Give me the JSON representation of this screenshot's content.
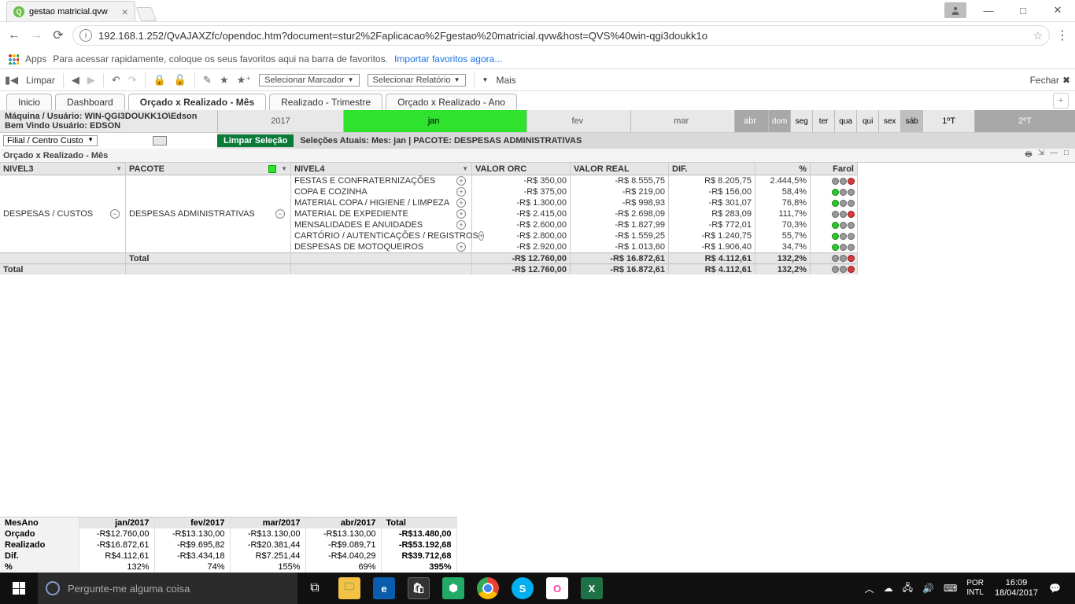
{
  "browser": {
    "tab_title": "gestao matricial.qvw",
    "url": "192.168.1.252/QvAJAXZfc/opendoc.htm?document=stur2%2Faplicacao%2Fgestao%20matricial.qvw&host=QVS%40win-qgi3doukk1o",
    "apps_label": "Apps",
    "bookmark_hint": "Para acessar rapidamente, coloque os seus favoritos aqui na barra de favoritos.",
    "import_link": "Importar favoritos agora..."
  },
  "qv_toolbar": {
    "clear": "Limpar",
    "bookmark_select": "Selecionar Marcador",
    "report_select": "Selecionar Relatório",
    "more": "Mais",
    "close": "Fechar"
  },
  "tabs": [
    "Inicio",
    "Dashboard",
    "Orçado x Realizado - Mês",
    "Realizado - Trimestre",
    "Orçado x Realizado - Ano"
  ],
  "active_tab": "Orçado x Realizado - Mês",
  "info": {
    "machine_user": "Máquina / Usuário: WIN-QGI3DOUKK1O\\Edson",
    "welcome": "Bem Vindo Usuário: EDSON",
    "year": "2017",
    "months": [
      "jan",
      "fev",
      "mar",
      "abr"
    ],
    "days": [
      "dom",
      "seg",
      "ter",
      "qua",
      "qui",
      "sex",
      "sáb"
    ],
    "quarters": [
      "1ºT",
      "2ºT"
    ]
  },
  "filter_label": "Filial / Centro Custo",
  "clear_sel": "Limpar Seleção",
  "current_sel": "Seleções Atuais: Mes: jan | PACOTE: DESPESAS ADMINISTRATIVAS",
  "object_title": "Orçado x Realizado - Mês",
  "pivot": {
    "cols": [
      "NIVEL3",
      "PACOTE",
      "NIVEL4",
      "VALOR ORC",
      "VALOR REAL",
      "DIF.",
      "%",
      "Farol"
    ],
    "nivel3": "DESPESAS / CUSTOS",
    "pacote": "DESPESAS ADMINISTRATIVAS",
    "rows": [
      {
        "n4": "FESTAS E CONFRATERNIZAÇÕES",
        "orc": "-R$ 350,00",
        "real": "-R$ 8.555,75",
        "dif": "R$ 8.205,75",
        "pct": "2.444,5%",
        "f": "r"
      },
      {
        "n4": "COPA E COZINHA",
        "orc": "-R$ 375,00",
        "real": "-R$ 219,00",
        "dif": "-R$ 156,00",
        "pct": "58,4%",
        "f": "g"
      },
      {
        "n4": "MATERIAL COPA / HIGIENE / LIMPEZA",
        "orc": "-R$ 1.300,00",
        "real": "-R$ 998,93",
        "dif": "-R$ 301,07",
        "pct": "76,8%",
        "f": "g"
      },
      {
        "n4": "MATERIAL DE EXPEDIENTE",
        "orc": "-R$ 2.415,00",
        "real": "-R$ 2.698,09",
        "dif": "R$ 283,09",
        "pct": "111,7%",
        "f": "r"
      },
      {
        "n4": "MENSALIDADES E ANUIDADES",
        "orc": "-R$ 2.600,00",
        "real": "-R$ 1.827,99",
        "dif": "-R$ 772,01",
        "pct": "70,3%",
        "f": "g"
      },
      {
        "n4": "CARTÓRIO / AUTENTICAÇÕES / REGISTROS",
        "orc": "-R$ 2.800,00",
        "real": "-R$ 1.559,25",
        "dif": "-R$ 1.240,75",
        "pct": "55,7%",
        "f": "g"
      },
      {
        "n4": "DESPESAS DE MOTOQUEIROS",
        "orc": "-R$ 2.920,00",
        "real": "-R$ 1.013,60",
        "dif": "-R$ 1.906,40",
        "pct": "34,7%",
        "f": "g"
      }
    ],
    "subtotal_label": "Total",
    "subtotal": {
      "orc": "-R$ 12.760,00",
      "real": "-R$ 16.872,61",
      "dif": "R$ 4.112,61",
      "pct": "132,2%",
      "f": "r"
    },
    "grand_label": "Total",
    "grand": {
      "orc": "-R$ 12.760,00",
      "real": "-R$ 16.872,61",
      "dif": "R$ 4.112,61",
      "pct": "132,2%",
      "f": "r"
    }
  },
  "summary": {
    "header_row": "MesAno",
    "cols": [
      "jan/2017",
      "fev/2017",
      "mar/2017",
      "abr/2017",
      "Total"
    ],
    "rows": [
      {
        "l": "Orçado",
        "v": [
          "-R$12.760,00",
          "-R$13.130,00",
          "-R$13.130,00",
          "-R$13.130,00",
          "-R$13.480,00"
        ]
      },
      {
        "l": "Realizado",
        "v": [
          "-R$16.872,61",
          "-R$9.695,82",
          "-R$20.381,44",
          "-R$9.089,71",
          "-R$53.192,68"
        ]
      },
      {
        "l": "Dif.",
        "v": [
          "R$4.112,61",
          "-R$3.434,18",
          "R$7.251,44",
          "-R$4.040,29",
          "R$39.712,68"
        ]
      },
      {
        "l": "%",
        "v": [
          "132%",
          "74%",
          "155%",
          "69%",
          "395%"
        ]
      }
    ]
  },
  "taskbar": {
    "search_placeholder": "Pergunte-me alguma coisa",
    "lang": "POR",
    "kb": "INTL",
    "time": "16:09",
    "date": "18/04/2017"
  }
}
